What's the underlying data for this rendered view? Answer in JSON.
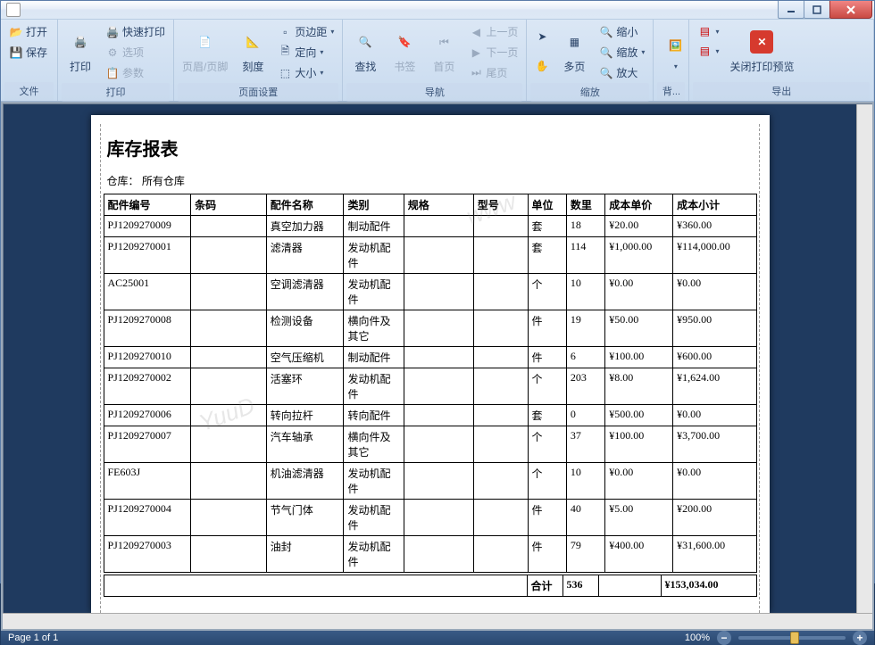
{
  "ribbon": {
    "groups": {
      "file": {
        "label": "文件",
        "open": "打开",
        "save": "保存"
      },
      "print": {
        "label": "打印",
        "print": "打印",
        "quick": "快速打印",
        "options": "选项",
        "params": "参数"
      },
      "pageSetup": {
        "label": "页面设置",
        "headerFooter": "页眉/页脚",
        "scale": "刻度",
        "margins": "页边距",
        "orient": "定向",
        "size": "大小"
      },
      "nav": {
        "label": "导航",
        "find": "查找",
        "bookmark": "书签",
        "first": "首页",
        "prev": "上一页",
        "next": "下一页",
        "last": "尾页"
      },
      "zoom": {
        "label": "缩放",
        "pointer": "",
        "hand": "",
        "pages": "多页",
        "zoomOut": "缩小",
        "zoomTo": "缩放",
        "zoomIn": "放大"
      },
      "bg": {
        "label": "背..."
      },
      "export": {
        "label": "导出",
        "close": "关闭打印预览"
      }
    }
  },
  "report": {
    "title": "库存报表",
    "warehouseLabel": "仓库：",
    "warehouseValue": "所有仓库",
    "headers": [
      "配件编号",
      "条码",
      "配件名称",
      "类别",
      "规格",
      "型号",
      "单位",
      "数里",
      "成本单价",
      "成本小计"
    ],
    "rows": [
      {
        "pn": "PJ1209270009",
        "bc": "",
        "nm": "真空加力器",
        "cat": "制动配件",
        "spec": "",
        "mdl": "",
        "un": "套",
        "qty": "18",
        "pr": "¥20.00",
        "sub": "¥360.00"
      },
      {
        "pn": "PJ1209270001",
        "bc": "",
        "nm": "滤清器",
        "cat": "发动机配件",
        "spec": "",
        "mdl": "",
        "un": "套",
        "qty": "114",
        "pr": "¥1,000.00",
        "sub": "¥114,000.00"
      },
      {
        "pn": "AC25001",
        "bc": "",
        "nm": "空调滤清器",
        "cat": "发动机配件",
        "spec": "",
        "mdl": "",
        "un": "个",
        "qty": "10",
        "pr": "¥0.00",
        "sub": "¥0.00"
      },
      {
        "pn": "PJ1209270008",
        "bc": "",
        "nm": "检测设备",
        "cat": "横向件及其它",
        "spec": "",
        "mdl": "",
        "un": "件",
        "qty": "19",
        "pr": "¥50.00",
        "sub": "¥950.00"
      },
      {
        "pn": "PJ1209270010",
        "bc": "",
        "nm": "空气压缩机",
        "cat": "制动配件",
        "spec": "",
        "mdl": "",
        "un": "件",
        "qty": "6",
        "pr": "¥100.00",
        "sub": "¥600.00"
      },
      {
        "pn": "PJ1209270002",
        "bc": "",
        "nm": "活塞环",
        "cat": "发动机配件",
        "spec": "",
        "mdl": "",
        "un": "个",
        "qty": "203",
        "pr": "¥8.00",
        "sub": "¥1,624.00"
      },
      {
        "pn": "PJ1209270006",
        "bc": "",
        "nm": "转向拉杆",
        "cat": "转向配件",
        "spec": "",
        "mdl": "",
        "un": "套",
        "qty": "0",
        "pr": "¥500.00",
        "sub": "¥0.00"
      },
      {
        "pn": "PJ1209270007",
        "bc": "",
        "nm": "汽车轴承",
        "cat": "横向件及其它",
        "spec": "",
        "mdl": "",
        "un": "个",
        "qty": "37",
        "pr": "¥100.00",
        "sub": "¥3,700.00"
      },
      {
        "pn": "FE603J",
        "bc": "",
        "nm": "机油滤清器",
        "cat": "发动机配件",
        "spec": "",
        "mdl": "",
        "un": "个",
        "qty": "10",
        "pr": "¥0.00",
        "sub": "¥0.00"
      },
      {
        "pn": "PJ1209270004",
        "bc": "",
        "nm": "节气门体",
        "cat": "发动机配件",
        "spec": "",
        "mdl": "",
        "un": "件",
        "qty": "40",
        "pr": "¥5.00",
        "sub": "¥200.00"
      },
      {
        "pn": "PJ1209270003",
        "bc": "",
        "nm": "油封",
        "cat": "发动机配件",
        "spec": "",
        "mdl": "",
        "un": "件",
        "qty": "79",
        "pr": "¥400.00",
        "sub": "¥31,600.00"
      }
    ],
    "totalLabel": "合计",
    "totalQty": "536",
    "totalSub": "¥153,034.00"
  },
  "status": {
    "page": "Page 1 of 1",
    "zoom": "100%"
  }
}
